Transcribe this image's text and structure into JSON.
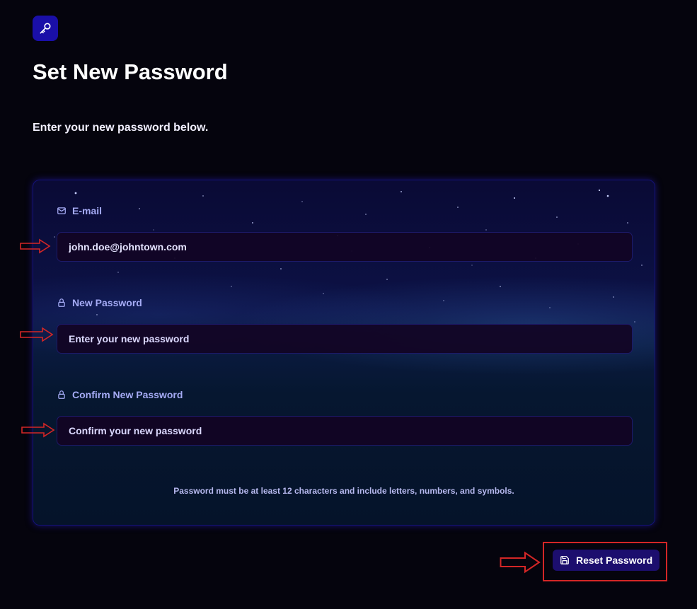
{
  "header": {
    "logo_icon": "key-icon",
    "title": "Set New Password",
    "subtitle": "Enter your new password below."
  },
  "form": {
    "email": {
      "label": "E-mail",
      "icon": "mail-icon",
      "value": "john.doe@johntown.com"
    },
    "new_password": {
      "label": "New Password",
      "icon": "lock-icon",
      "value": "",
      "placeholder": "Enter your new password"
    },
    "confirm_password": {
      "label": "Confirm New Password",
      "icon": "lock-icon",
      "value": "",
      "placeholder": "Confirm your new password"
    },
    "hint": "Password must be at least 12 characters and include letters, numbers, and symbols."
  },
  "actions": {
    "reset_label": "Reset Password",
    "reset_icon": "save-icon"
  },
  "annotations": {
    "arrow_color": "#d42626",
    "highlight_color": "#d42626"
  },
  "colors": {
    "background": "#05040d",
    "accent": "#1a0fa8",
    "label": "#a5abf5",
    "button": "#1c0e6e"
  }
}
